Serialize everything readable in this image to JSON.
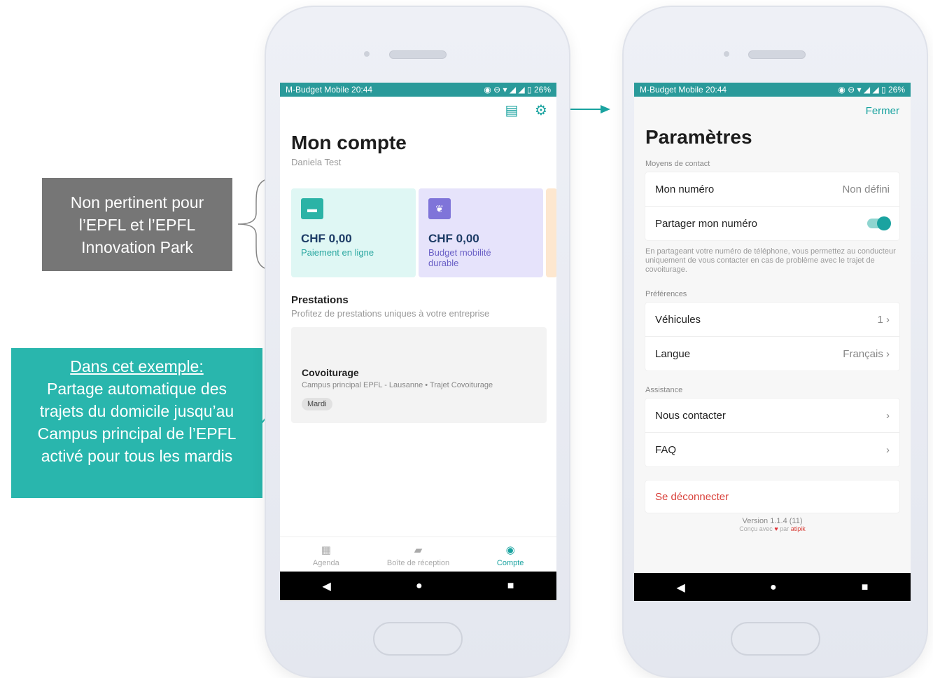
{
  "annotations": {
    "grey": [
      "Non pertinent pour",
      "l’EPFL et l’EPFL",
      "Innovation Park"
    ],
    "teal_heading": "Dans cet exemple:",
    "teal_lines": [
      "Partage automatique des",
      "trajets du domicile jusqu’au",
      "Campus principal de l’EPFL",
      "activé pour tous les mardis"
    ]
  },
  "statusbar": {
    "left": "M-Budget Mobile 20:44",
    "right": "26%"
  },
  "left_screen": {
    "title": "Mon compte",
    "user_name": "Daniela Test",
    "cards": [
      {
        "amount": "CHF 0,00",
        "label": "Paiement en ligne"
      },
      {
        "amount": "CHF 0,00",
        "label": "Budget mobilité durable"
      }
    ],
    "prestations_title": "Prestations",
    "prestations_subtitle": "Profitez de prestations uniques à votre entreprise",
    "service": {
      "title": "Covoiturage",
      "subtitle": "Campus principal EPFL - Lausanne • Trajet Covoiturage",
      "chip": "Mardi"
    },
    "tabs": [
      {
        "label": "Agenda",
        "icon": "calendar-icon"
      },
      {
        "label": "Boîte de réception",
        "icon": "chat-icon"
      },
      {
        "label": "Compte",
        "icon": "user-circle-icon"
      }
    ]
  },
  "right_screen": {
    "close_label": "Fermer",
    "title": "Paramètres",
    "section_contact": "Moyens de contact",
    "my_number_label": "Mon numéro",
    "my_number_value": "Non défini",
    "share_number_label": "Partager mon numéro",
    "share_note": "En partageant votre numéro de téléphone, vous permettez au conducteur uniquement de vous contacter en cas de problème avec le trajet de covoiturage.",
    "section_prefs": "Préférences",
    "vehicles_label": "Véhicules",
    "vehicles_value": "1",
    "language_label": "Langue",
    "language_value": "Français",
    "section_assist": "Assistance",
    "contact_label": "Nous contacter",
    "faq_label": "FAQ",
    "logout_label": "Se déconnecter",
    "version": "Version 1.1.4 (11)",
    "made_with": "Conçu avec",
    "made_by_prefix": "par",
    "made_by": "atipik"
  },
  "colors": {
    "accent": "#1aa3a0",
    "teal_note": "#29b6ad",
    "grey_note": "#767676",
    "danger": "#d9403a"
  }
}
